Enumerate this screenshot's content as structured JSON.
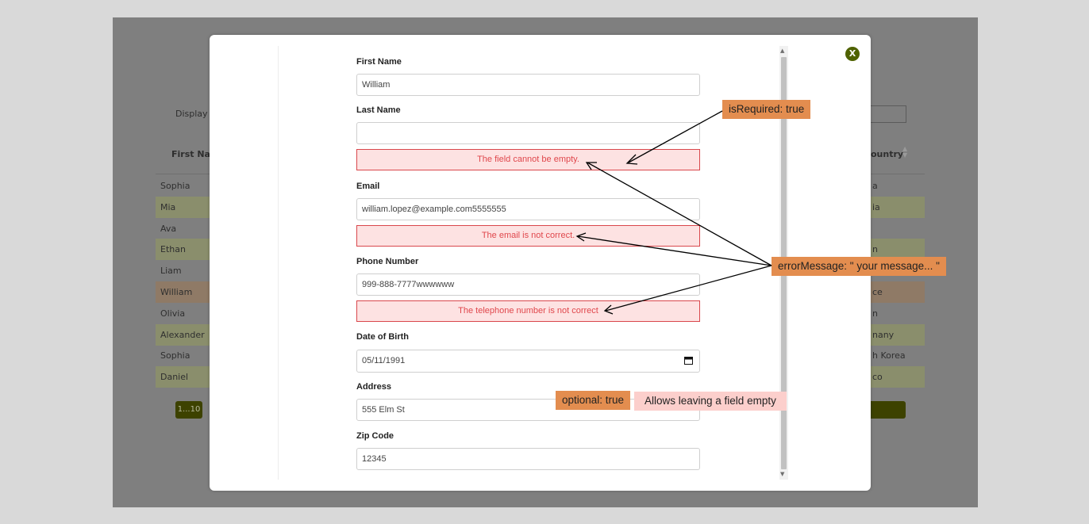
{
  "background": {
    "display_label": "Display E",
    "first_name_header": "First Nam",
    "country_header": "ountry",
    "rows": [
      {
        "left": "Sophia",
        "right": "a",
        "color": "none"
      },
      {
        "left": "Mia",
        "right": "ia",
        "color": "green"
      },
      {
        "left": "Ava",
        "right": "",
        "color": "none"
      },
      {
        "left": "Ethan",
        "right": "n",
        "color": "green"
      },
      {
        "left": "Liam",
        "right": "",
        "color": "none"
      },
      {
        "left": "William",
        "right": "ce",
        "color": "orange"
      },
      {
        "left": "Olivia",
        "right": "n",
        "color": "none"
      },
      {
        "left": "Alexander",
        "right": "nany",
        "color": "green"
      },
      {
        "left": "Sophia",
        "right": "h Korea",
        "color": "none"
      },
      {
        "left": "Daniel",
        "right": "co",
        "color": "green"
      }
    ],
    "pager_label": "1...10"
  },
  "modal": {
    "close_label": "X"
  },
  "form": {
    "first_name": {
      "label": "First Name",
      "value": "William"
    },
    "last_name": {
      "label": "Last Name",
      "value": "",
      "error": "The field cannot be empty."
    },
    "email": {
      "label": "Email",
      "value": "william.lopez@example.com5555555",
      "error": "The email is not correct."
    },
    "phone": {
      "label": "Phone Number",
      "value": "999-888-7777wwwwww",
      "error": "The telephone number is not correct"
    },
    "dob": {
      "label": "Date of Birth",
      "value": "05/11/1991"
    },
    "address": {
      "label": "Address",
      "value": "555 Elm St"
    },
    "zip": {
      "label": "Zip Code",
      "value": "12345"
    }
  },
  "annotations": {
    "is_required": "isRequired: true",
    "error_message": "errorMessage: \" your message... \"",
    "optional": "optional: true",
    "optional_desc": "Allows leaving a field empty"
  },
  "colors": {
    "accent": "#4f6200",
    "error_border": "#d9474c",
    "error_bg": "#fde2e2",
    "note_orange": "#e38d4f",
    "note_pink": "#fccfcc"
  }
}
